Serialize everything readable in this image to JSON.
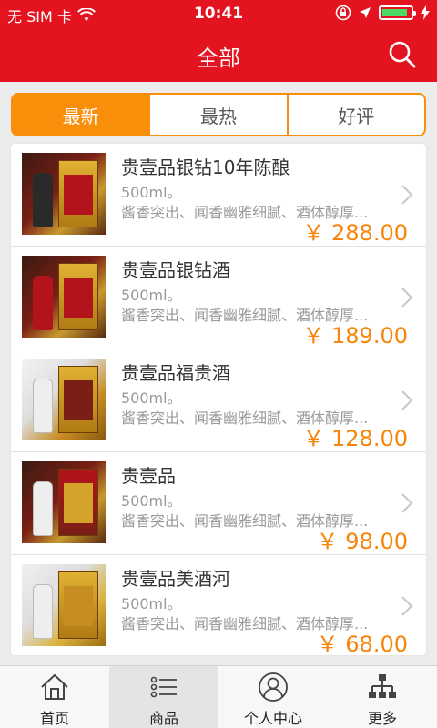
{
  "status_bar": {
    "carrier": "无 SIM 卡",
    "time": "10:41"
  },
  "nav": {
    "title": "全部"
  },
  "segments": [
    {
      "label": "最新",
      "active": true
    },
    {
      "label": "最热",
      "active": false
    },
    {
      "label": "好评",
      "active": false
    }
  ],
  "products": [
    {
      "title": "贵壹品银钻10年陈酿",
      "volume": "500ml。",
      "desc": "酱香突出、闻香幽雅细腻、酒体醇厚...",
      "price": "￥ 288.00"
    },
    {
      "title": "贵壹品银钻酒",
      "volume": "500ml。",
      "desc": "酱香突出、闻香幽雅细腻、酒体醇厚...",
      "price": "￥ 189.00"
    },
    {
      "title": "贵壹品福贵酒",
      "volume": "500ml。",
      "desc": "酱香突出、闻香幽雅细腻、酒体醇厚...",
      "price": "￥ 128.00"
    },
    {
      "title": "贵壹品",
      "volume": "500ml。",
      "desc": "酱香突出、闻香幽雅细腻、酒体醇厚...",
      "price": "￥ 98.00"
    },
    {
      "title": "贵壹品美酒河",
      "volume": "500ml。",
      "desc": "酱香突出、闻香幽雅细腻、酒体醇厚...",
      "price": "￥ 68.00"
    }
  ],
  "tabs": [
    {
      "label": "首页",
      "icon": "home-icon",
      "active": false
    },
    {
      "label": "商品",
      "icon": "list-icon",
      "active": true
    },
    {
      "label": "个人中心",
      "icon": "user-icon",
      "active": false
    },
    {
      "label": "更多",
      "icon": "sitemap-icon",
      "active": false
    }
  ],
  "colors": {
    "brand_red": "#e3141f",
    "accent_orange": "#f98e0a",
    "price_orange": "#f7850a"
  }
}
